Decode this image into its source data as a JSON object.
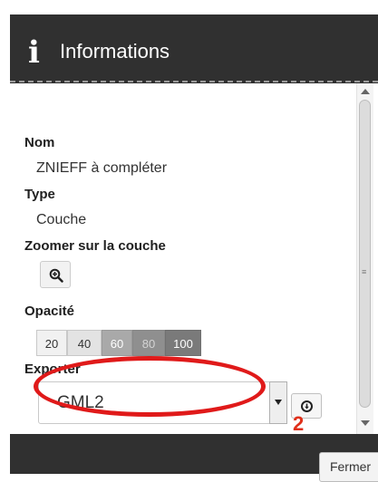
{
  "dialog": {
    "title": "Informations",
    "info_icon": "i"
  },
  "fields": {
    "name_label": "Nom",
    "name_value": "ZNIEFF à compléter",
    "type_label": "Type",
    "type_value": "Couche",
    "zoom_label": "Zoomer sur la couche",
    "zoom_icon": "zoom-in-icon",
    "opacity_label": "Opacité",
    "opacity_options": [
      "20",
      "40",
      "60",
      "80",
      "100"
    ],
    "export_label": "Exporter",
    "export_format": "GML2",
    "export_icon": "download-icon"
  },
  "annotation": {
    "step_number": "2",
    "color": "#e01a1a"
  },
  "footer": {
    "close_label": "Fermer"
  }
}
